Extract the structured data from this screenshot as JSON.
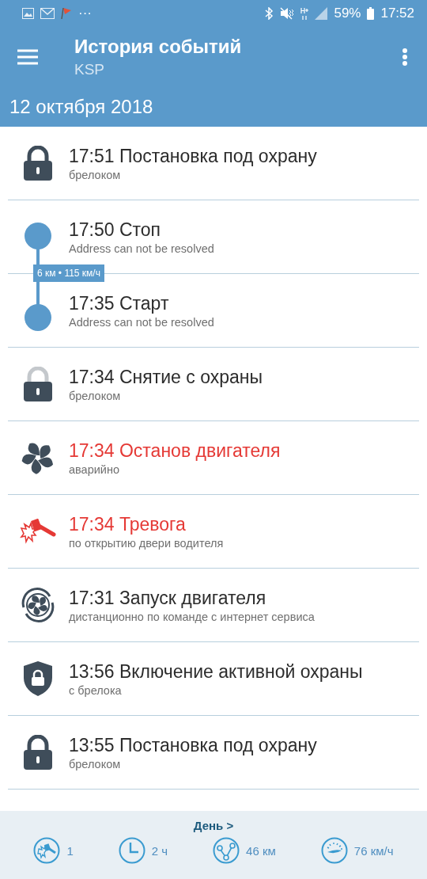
{
  "status_bar": {
    "time": "17:52",
    "battery": "59%",
    "notification_more": "···"
  },
  "toolbar": {
    "title": "История событий",
    "subtitle": "KSP"
  },
  "date_header": "12 октября 2018",
  "events": [
    {
      "kind": "armed",
      "title": "17:51 Постановка под охрану",
      "subtitle": "брелоком",
      "alert": false
    },
    {
      "kind": "trip_stop",
      "title": "17:50 Стоп",
      "subtitle": "Address can not be resolved",
      "alert": false,
      "segment": "6 км • 115 км/ч"
    },
    {
      "kind": "trip_start",
      "title": "17:35 Старт",
      "subtitle": "Address can not be resolved",
      "alert": false
    },
    {
      "kind": "disarmed",
      "title": "17:34 Снятие с охраны",
      "subtitle": "брелоком",
      "alert": false
    },
    {
      "kind": "engine_stop",
      "title": "17:34 Останов двигателя",
      "subtitle": "аварийно",
      "alert": true
    },
    {
      "kind": "alarm",
      "title": "17:34 Тревога",
      "subtitle": "по открытию двери водителя",
      "alert": true
    },
    {
      "kind": "engine_start",
      "title": "17:31 Запуск двигателя",
      "subtitle": "дистанционно по команде с интернет сервиса",
      "alert": false
    },
    {
      "kind": "active_guard",
      "title": "13:56 Включение активной охраны",
      "subtitle": "с брелока",
      "alert": false
    },
    {
      "kind": "armed",
      "title": "13:55 Постановка под охрану",
      "subtitle": "брелоком",
      "alert": false
    }
  ],
  "summary": {
    "period_link": "День >",
    "stats": [
      {
        "kind": "alarms",
        "value": "1"
      },
      {
        "kind": "duration",
        "value": "2 ч"
      },
      {
        "kind": "distance",
        "value": "46 км"
      },
      {
        "kind": "speed",
        "value": "76 км/ч"
      }
    ]
  }
}
